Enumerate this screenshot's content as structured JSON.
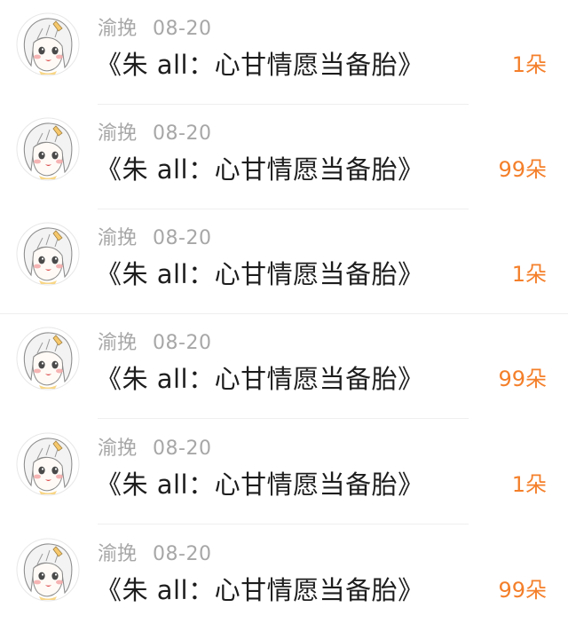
{
  "accent_color": "#f47f2a",
  "items": [
    {
      "avatar_icon": "anime-girl-avatar-icon",
      "user": "渝挽",
      "date": "08-20",
      "title": "《朱 all：心甘情愿当备胎》",
      "count": "1朵"
    },
    {
      "avatar_icon": "anime-girl-avatar-icon",
      "user": "渝挽",
      "date": "08-20",
      "title": "《朱 all：心甘情愿当备胎》",
      "count": "99朵"
    },
    {
      "avatar_icon": "anime-girl-avatar-icon",
      "user": "渝挽",
      "date": "08-20",
      "title": "《朱 all：心甘情愿当备胎》",
      "count": "1朵"
    },
    {
      "avatar_icon": "anime-girl-avatar-icon",
      "user": "渝挽",
      "date": "08-20",
      "title": "《朱 all：心甘情愿当备胎》",
      "count": "99朵"
    },
    {
      "avatar_icon": "anime-girl-avatar-icon",
      "user": "渝挽",
      "date": "08-20",
      "title": "《朱 all：心甘情愿当备胎》",
      "count": "1朵"
    },
    {
      "avatar_icon": "anime-girl-avatar-icon",
      "user": "渝挽",
      "date": "08-20",
      "title": "《朱 all：心甘情愿当备胎》",
      "count": "99朵"
    }
  ]
}
